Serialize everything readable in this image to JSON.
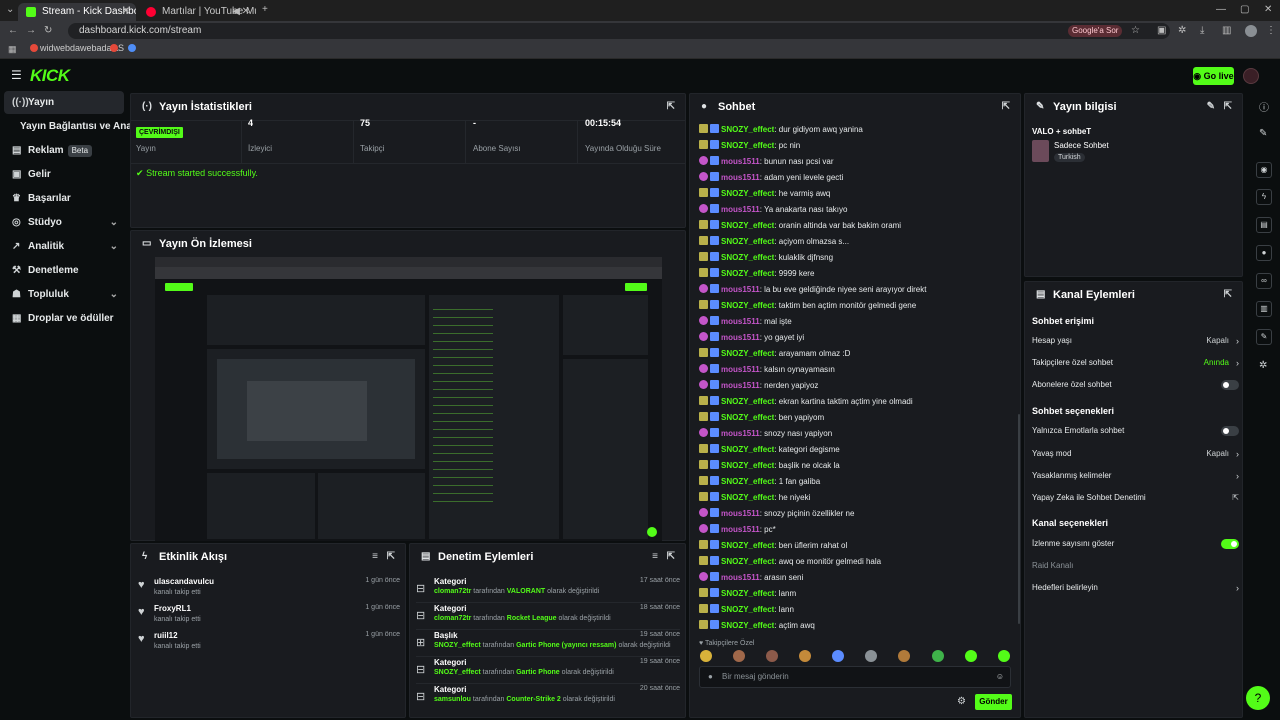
{
  "browser": {
    "tabs": [
      {
        "title": "Stream - Kick Dashboard"
      },
      {
        "title": "Martılar | YouTube Music"
      }
    ],
    "url": "dashboard.kick.com/stream",
    "google_button": "Google'a Sor",
    "bookmarks": [
      "widwebdawebada...",
      "S"
    ]
  },
  "header": {
    "logo": "KICK",
    "go_live": "Go live"
  },
  "sidebar": {
    "items": [
      {
        "label": "Yayın",
        "icon": "broadcast-icon"
      },
      {
        "label": "Yayın Bağlantısı ve Anahtarı",
        "icon": ""
      },
      {
        "label": "Reklam",
        "icon": "ad-icon",
        "badge": "Beta"
      },
      {
        "label": "Gelir",
        "icon": "wallet-icon"
      },
      {
        "label": "Başarılar",
        "icon": "trophy-icon"
      },
      {
        "label": "Stüdyo",
        "icon": "studio-icon"
      },
      {
        "label": "Analitik",
        "icon": "chart-icon"
      },
      {
        "label": "Denetleme",
        "icon": "hammer-icon"
      },
      {
        "label": "Topluluk",
        "icon": "community-icon"
      },
      {
        "label": "Droplar ve ödüller",
        "icon": "gift-icon"
      }
    ]
  },
  "stats": {
    "title": "Yayın İstatistikleri",
    "status_badge": "ÇEVRİMDIŞI",
    "status_label": "Yayın",
    "viewers_value": "4",
    "viewers_label": "İzleyici",
    "followers_value": "75",
    "followers_label": "Takipçi",
    "subs_value": "-",
    "subs_label": "Abone Sayısı",
    "duration_value": "00:15:54",
    "duration_label": "Yayında Olduğu Süre",
    "success_msg": "Stream started successfully."
  },
  "preview": {
    "title": "Yayın Ön İzlemesi"
  },
  "activity": {
    "title": "Etkinlik Akışı",
    "rows": [
      {
        "name": "ulascandavulcu",
        "sub": "kanalı takip etti",
        "time": "1 gün önce"
      },
      {
        "name": "FroxyRL1",
        "sub": "kanalı takip etti",
        "time": "1 gün önce"
      },
      {
        "name": "ruiil12",
        "sub": "kanalı takip etti",
        "time": "1 gün önce"
      }
    ]
  },
  "moderation": {
    "title": "Denetim Eylemleri",
    "rows": [
      {
        "title": "Kategori",
        "user": "cloman72tr",
        "mid": " tarafından ",
        "target": "VALORANT",
        "end": " olarak değiştirildi",
        "time": "17 saat önce"
      },
      {
        "title": "Kategori",
        "user": "cloman72tr",
        "mid": " tarafından ",
        "target": "Rocket League",
        "end": " olarak değiştirildi",
        "time": "18 saat önce"
      },
      {
        "title": "Başlık",
        "user": "SNOZY_effect",
        "mid": " tarafından ",
        "target": "Gartic Phone (yayıncı ressam)",
        "end": " olarak değiştirildi",
        "time": "19 saat önce"
      },
      {
        "title": "Kategori",
        "user": "SNOZY_effect",
        "mid": " tarafından ",
        "target": "Gartic Phone",
        "end": " olarak değiştirildi",
        "time": "19 saat önce"
      },
      {
        "title": "Kategori",
        "user": "samsunlou",
        "mid": " tarafından ",
        "target": "Counter-Strike 2",
        "end": " olarak değiştirildi",
        "time": "20 saat önce"
      }
    ]
  },
  "chat": {
    "title": "Sohbet",
    "messages": [
      {
        "user": "SNOZY_effect",
        "text": "dur gidiyom awq yanina"
      },
      {
        "user": "SNOZY_effect",
        "text": "pc nin"
      },
      {
        "user": "mous1511",
        "text": "bunun nası pcsi var"
      },
      {
        "user": "mous1511",
        "text": "adam yeni levele gecti"
      },
      {
        "user": "SNOZY_effect",
        "text": "he varmiş awq"
      },
      {
        "user": "mous1511",
        "text": "Ya anakarta nası takıyo"
      },
      {
        "user": "SNOZY_effect",
        "text": "oranin altinda var bak bakim orami"
      },
      {
        "user": "SNOZY_effect",
        "text": "açiyom olmazsa s..."
      },
      {
        "user": "SNOZY_effect",
        "text": "kulaklik djfnsng"
      },
      {
        "user": "SNOZY_effect",
        "text": "9999 kere"
      },
      {
        "user": "mous1511",
        "text": "la bu eve geldiğinde niyee seni arayıyor direkt"
      },
      {
        "user": "SNOZY_effect",
        "text": "taktim ben açtim monitör gelmedi gene"
      },
      {
        "user": "mous1511",
        "text": "mal işte"
      },
      {
        "user": "mous1511",
        "text": "yo gayet iyi"
      },
      {
        "user": "SNOZY_effect",
        "text": "arayamam olmaz :D"
      },
      {
        "user": "mous1511",
        "text": "kalsın oynayamasın"
      },
      {
        "user": "mous1511",
        "text": "nerden yapiyoz"
      },
      {
        "user": "SNOZY_effect",
        "text": "ekran kartina taktim açtim yine olmadi"
      },
      {
        "user": "SNOZY_effect",
        "text": "ben yapiyom"
      },
      {
        "user": "mous1511",
        "text": "snozy nası yapiyon"
      },
      {
        "user": "SNOZY_effect",
        "text": "kategori degisme"
      },
      {
        "user": "SNOZY_effect",
        "text": "başlik ne olcak la"
      },
      {
        "user": "SNOZY_effect",
        "text": "1 fan galiba"
      },
      {
        "user": "SNOZY_effect",
        "text": "he niyeki"
      },
      {
        "user": "mous1511",
        "text": "snozy piçinin özellikler ne"
      },
      {
        "user": "mous1511",
        "text": "pc*"
      },
      {
        "user": "SNOZY_effect",
        "text": "ben üflerim rahat ol"
      },
      {
        "user": "SNOZY_effect",
        "text": "awq oe monitör gelmedi hala"
      },
      {
        "user": "mous1511",
        "text": "arasın seni"
      },
      {
        "user": "SNOZY_effect",
        "text": "lanm"
      },
      {
        "user": "SNOZY_effect",
        "text": "lann"
      },
      {
        "user": "SNOZY_effect",
        "text": "açtim awq"
      }
    ],
    "followers_only": "Takipçilere Özel",
    "input_placeholder": "Bir mesaj gönderin",
    "send": "Gönder"
  },
  "info": {
    "title": "Yayın bilgisi",
    "stream_title": "VALO + sohbeT",
    "category": "Sadece Sohbet",
    "tag": "Turkish"
  },
  "channel_actions": {
    "title": "Kanal Eylemleri",
    "chat_access": "Sohbet erişimi",
    "account_age": "Hesap yaşı",
    "account_age_value": "Kapalı",
    "followers_chat": "Takipçilere özel sohbet",
    "followers_chat_value": "Anında",
    "subs_chat": "Abonelere özel sohbet",
    "chat_options": "Sohbet seçenekleri",
    "emote_only": "Yalnızca Emotlarla sohbet",
    "slow_mode": "Yavaş mod",
    "slow_mode_value": "Kapalı",
    "banned_words": "Yasaklanmış kelimeler",
    "ai_moderation": "Yapay Zeka ile Sohbet Denetimi",
    "channel_options": "Kanal seçenekleri",
    "show_viewers": "İzlenme sayısını göster",
    "raid": "Raid Kanalı",
    "goals": "Hedefleri belirleyin"
  },
  "colors": {
    "accent": "#53fc18",
    "snozy_badge": "#5b8cff",
    "mous_badge": "#c455c9"
  }
}
